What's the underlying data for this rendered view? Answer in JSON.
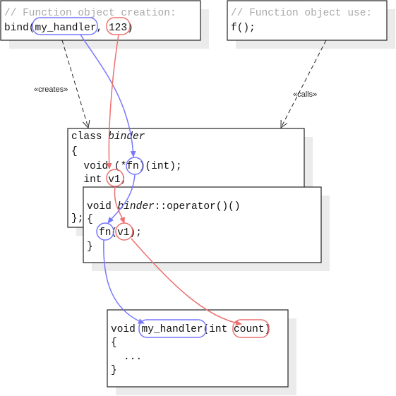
{
  "creation_box": {
    "comment": "// Function object creation:",
    "code_pre": "bind(",
    "arg1": "my_handler",
    "sep": ", ",
    "arg2": "123",
    "code_post": ")"
  },
  "use_box": {
    "comment": "// Function object use:",
    "code": "f();"
  },
  "binder_class": {
    "kw": "class ",
    "name": "binder",
    "open": "{",
    "line1_pre": "  void (",
    "line1_fn": "*fn",
    "line1_post": ")(int);",
    "line2_pre": "  int ",
    "line2_v": "v1",
    "line2_post": ";",
    "close": "};"
  },
  "operator_box": {
    "pre": "void ",
    "name": "binder",
    "post": "::operator()()",
    "open": "{",
    "call_fn": "fn",
    "call_v": "v1",
    "call_post": ");",
    "close": "}"
  },
  "handler_box": {
    "pre": "void ",
    "name": "my_handler",
    "mid": "(int ",
    "param": "count",
    "post": ")",
    "open": "{",
    "body": "...",
    "close": "}"
  },
  "labels": {
    "creates": "«creates»",
    "calls": "«calls»"
  },
  "colors": {
    "function_flow": "#7777ff",
    "value_flow": "#ec7070",
    "shadow": "#ebebeb"
  }
}
